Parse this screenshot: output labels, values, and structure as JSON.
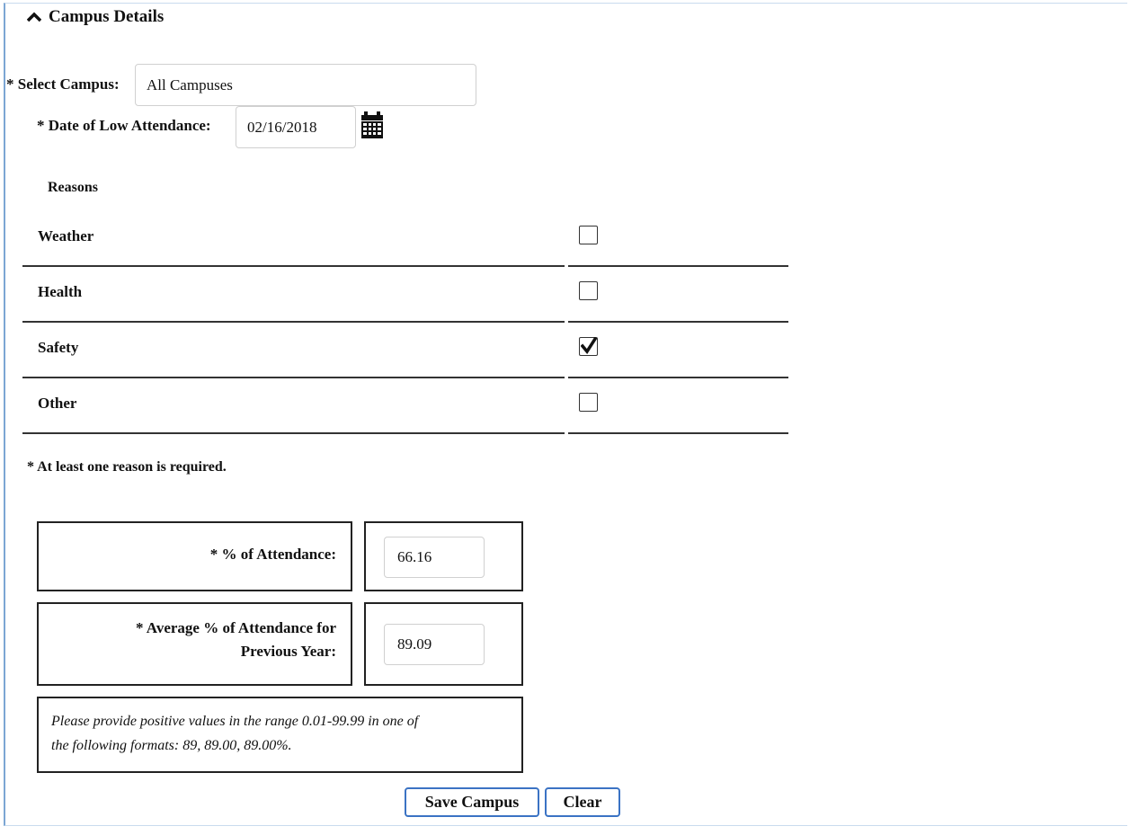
{
  "section": {
    "title": "Campus Details",
    "toggle_icon": "chevron-up-icon"
  },
  "campus": {
    "label": "* Select Campus:",
    "value": "All Campuses"
  },
  "date": {
    "label": "* Date of Low Attendance:",
    "value": "02/16/2018",
    "icon": "calendar-icon"
  },
  "reasons": {
    "heading": "Reasons",
    "items": [
      {
        "label": "Weather",
        "checked": false
      },
      {
        "label": "Health",
        "checked": false
      },
      {
        "label": "Safety",
        "checked": true
      },
      {
        "label": "Other",
        "checked": false
      }
    ],
    "required_note": "* At least one reason is required."
  },
  "attendance": {
    "percent_label": "* % of Attendance:",
    "percent_value": "66.16",
    "avg_label_line1": "* Average % of Attendance for",
    "avg_label_line2": "Previous Year:",
    "avg_value": "89.09",
    "help_line1": "Please provide positive values in the range 0.01-99.99 in one of",
    "help_line2": "the following formats: 89, 89.00, 89.00%."
  },
  "buttons": {
    "save_label": "Save Campus",
    "clear_label": "Clear"
  },
  "colors": {
    "button_border": "#3b73c4",
    "frame_border": "#7ca6d4"
  }
}
